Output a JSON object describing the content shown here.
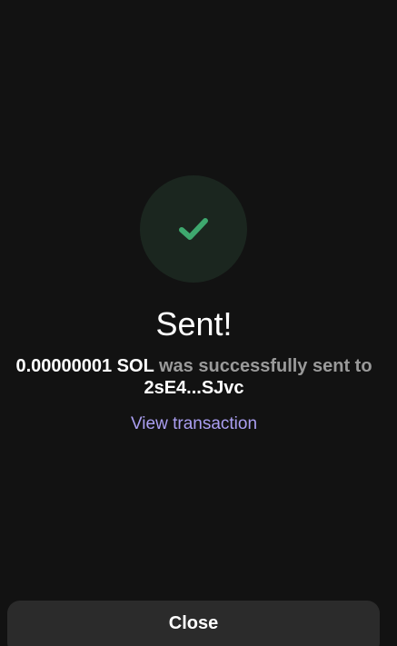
{
  "status": {
    "icon": "checkmark-icon",
    "title": "Sent!"
  },
  "message": {
    "amount": "0.00000001 SOL",
    "text": "was successfully sent to",
    "address": "2sE4...SJvc"
  },
  "link": {
    "label": "View transaction"
  },
  "actions": {
    "close_label": "Close"
  },
  "colors": {
    "background": "#121212",
    "success_circle": "#1b261f",
    "success_check": "#3ea86e",
    "link": "#ab9ff2",
    "button": "#2b2b2b",
    "muted_text": "#9a9a9a"
  }
}
